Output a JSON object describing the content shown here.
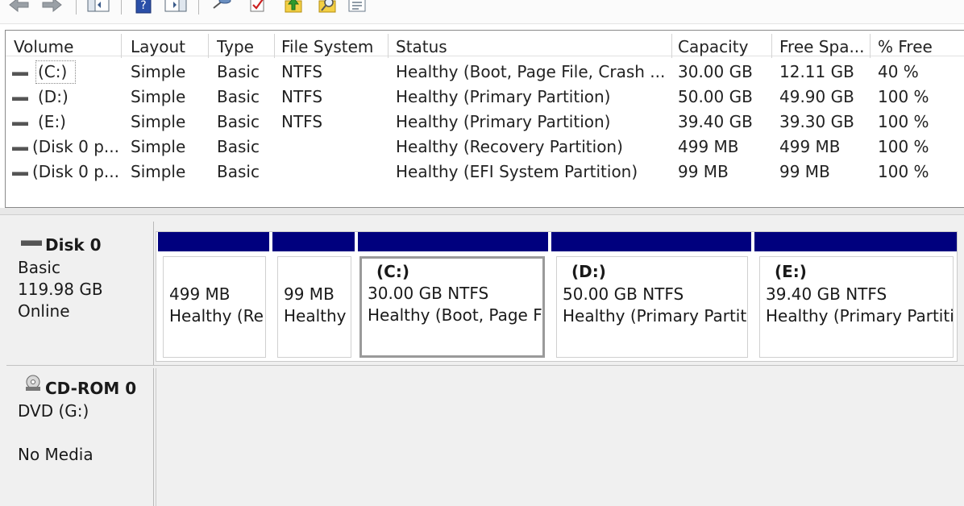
{
  "toolbar": {
    "buttons": [
      {
        "icon": "back-arrow-icon"
      },
      {
        "icon": "forward-arrow-icon"
      },
      {
        "icon": "show-hide-console-tree-icon"
      },
      {
        "icon": "help-icon"
      },
      {
        "icon": "show-hide-action-pane-icon"
      },
      {
        "icon": "connect-disk-icon"
      },
      {
        "icon": "check-icon"
      },
      {
        "icon": "upload-icon"
      },
      {
        "icon": "search-icon"
      },
      {
        "icon": "properties-icon"
      }
    ]
  },
  "volume_list": {
    "columns": [
      "Volume",
      "Layout",
      "Type",
      "File System",
      "Status",
      "Capacity",
      "Free Spa...",
      "% Free"
    ],
    "rows": [
      {
        "volume": "(C:)",
        "layout": "Simple",
        "type": "Basic",
        "fs": "NTFS",
        "status": "Healthy (Boot, Page File, Crash ...",
        "capacity": "30.00 GB",
        "free": "12.11 GB",
        "pct": "40 %"
      },
      {
        "volume": "(D:)",
        "layout": "Simple",
        "type": "Basic",
        "fs": "NTFS",
        "status": "Healthy (Primary Partition)",
        "capacity": "50.00 GB",
        "free": "49.90 GB",
        "pct": "100 %"
      },
      {
        "volume": "(E:)",
        "layout": "Simple",
        "type": "Basic",
        "fs": "NTFS",
        "status": "Healthy (Primary Partition)",
        "capacity": "39.40 GB",
        "free": "39.30 GB",
        "pct": "100 %"
      },
      {
        "volume": "(Disk 0 p...",
        "layout": "Simple",
        "type": "Basic",
        "fs": "",
        "status": "Healthy (Recovery Partition)",
        "capacity": "499 MB",
        "free": "499 MB",
        "pct": "100 %"
      },
      {
        "volume": "(Disk 0 p...",
        "layout": "Simple",
        "type": "Basic",
        "fs": "",
        "status": "Healthy (EFI System Partition)",
        "capacity": "99 MB",
        "free": "99 MB",
        "pct": "100 %"
      }
    ]
  },
  "disk0": {
    "name": "Disk 0",
    "type": "Basic",
    "size": "119.98 GB",
    "state": "Online",
    "partitions": [
      {
        "letter": "",
        "size": "499 MB",
        "status": "Healthy (Re"
      },
      {
        "letter": "",
        "size": "99 MB",
        "status": "Healthy"
      },
      {
        "letter": "(C:)",
        "size": "30.00 GB NTFS",
        "status": "Healthy (Boot, Page Fi"
      },
      {
        "letter": "(D:)",
        "size": "50.00 GB NTFS",
        "status": "Healthy (Primary Partiti"
      },
      {
        "letter": "(E:)",
        "size": "39.40 GB NTFS",
        "status": "Healthy (Primary Partiti"
      }
    ]
  },
  "cdrom0": {
    "name": "CD-ROM 0",
    "drive": "DVD (G:)",
    "media": "No Media"
  },
  "colors": {
    "partition_bar": "#00007e",
    "background": "#f0f0f0"
  }
}
